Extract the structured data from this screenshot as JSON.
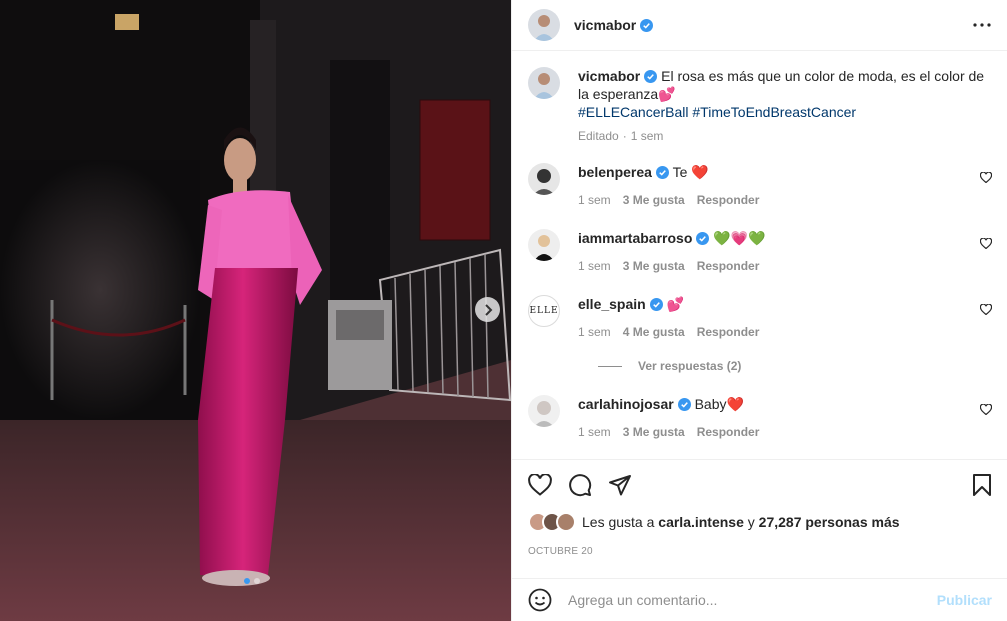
{
  "post": {
    "username": "vicmabor",
    "caption": "El rosa es más que un color de moda, es el color de la esperanza💕",
    "hashtags": "#ELLECancerBall #TimeToEndBreastCancer",
    "edited": "Editado",
    "time": "1 sem"
  },
  "comments": [
    {
      "username": "belenperea",
      "text": "Te ❤️",
      "time": "1 sem",
      "likes": "3 Me gusta",
      "reply": "Responder"
    },
    {
      "username": "iammartabarroso",
      "text": "💚💗💚",
      "time": "1 sem",
      "likes": "3 Me gusta",
      "reply": "Responder"
    },
    {
      "username": "elle_spain",
      "text": "💕",
      "time": "1 sem",
      "likes": "4 Me gusta",
      "reply": "Responder",
      "avatar_text": "ELLE"
    },
    {
      "username": "carlahinojosar",
      "text": "Baby❤️",
      "time": "1 sem",
      "likes": "3 Me gusta",
      "reply": "Responder"
    }
  ],
  "view_replies": "Ver respuestas (2)",
  "likes_summary": {
    "prefix": "Les gusta a",
    "user": "carla.intense",
    "joiner": "y",
    "count": "27,287 personas más"
  },
  "date": "OCTUBRE 20",
  "add_comment": {
    "placeholder": "Agrega un comentario...",
    "publish": "Publicar"
  },
  "carousel": {
    "current": 1,
    "total": 2
  },
  "icons": {
    "verified": "verified-badge-icon",
    "more": "more-options-icon",
    "like": "heart-icon",
    "comment": "comment-icon",
    "share": "share-icon",
    "save": "bookmark-icon",
    "emoji": "emoji-icon",
    "next": "chevron-right-icon"
  },
  "colors": {
    "link": "#00376b",
    "verified": "#3897f0",
    "muted": "#8e8e8e",
    "publish": "#b2dffc"
  }
}
